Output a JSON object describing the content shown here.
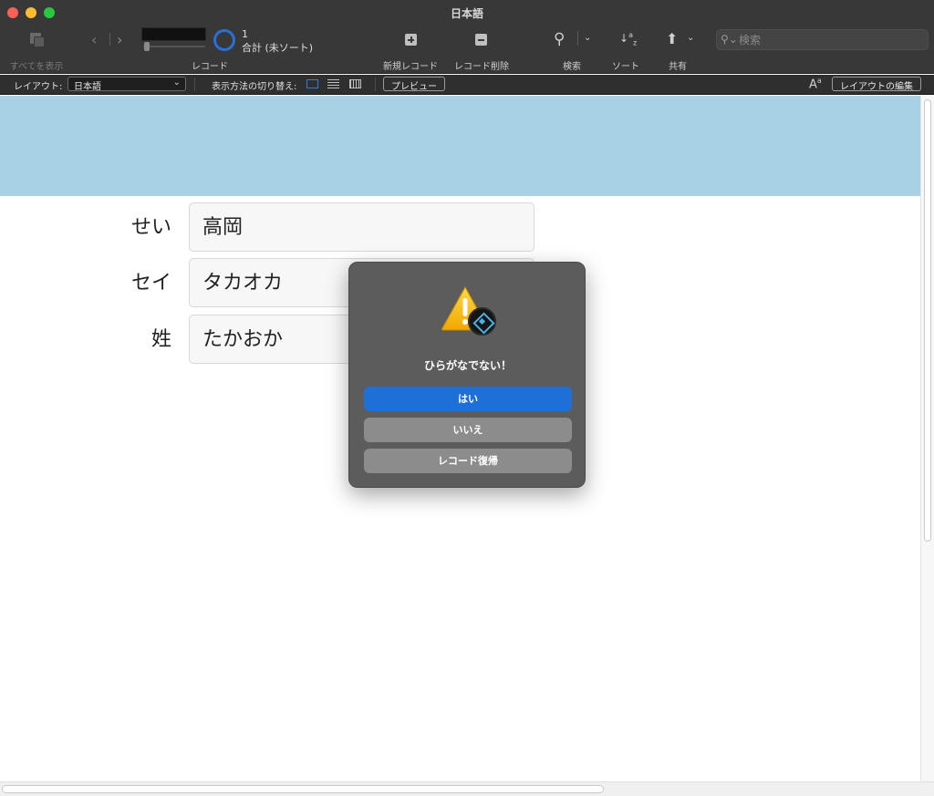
{
  "window": {
    "title": "日本語"
  },
  "toolbar": {
    "show_all_label": "すべてを表示",
    "records_label": "レコード",
    "record_count": "1",
    "record_total": "合計 (未ソート)",
    "new_record_label": "新規レコード",
    "delete_record_label": "レコード削除",
    "find_label": "検索",
    "sort_label": "ソート",
    "share_label": "共有",
    "search_placeholder": "検索"
  },
  "layout_bar": {
    "layout_label": "レイアウト:",
    "layout_value": "日本語",
    "view_as_label": "表示方法の切り替え:",
    "preview_button": "プレビュー",
    "edit_layout_button": "レイアウトの編集"
  },
  "fields": [
    {
      "label": "せい",
      "value": "高岡"
    },
    {
      "label": "セイ",
      "value": "タカオカ"
    },
    {
      "label": "姓",
      "value": "たかおか"
    }
  ],
  "dialog": {
    "message": "ひらがなでない！",
    "buttons": {
      "yes": "はい",
      "no": "いいえ",
      "revert": "レコード復帰"
    }
  },
  "colors": {
    "header_band": "#a8d1e6",
    "primary_button": "#1f6fd9",
    "dialog_bg": "#5c5c5c"
  }
}
